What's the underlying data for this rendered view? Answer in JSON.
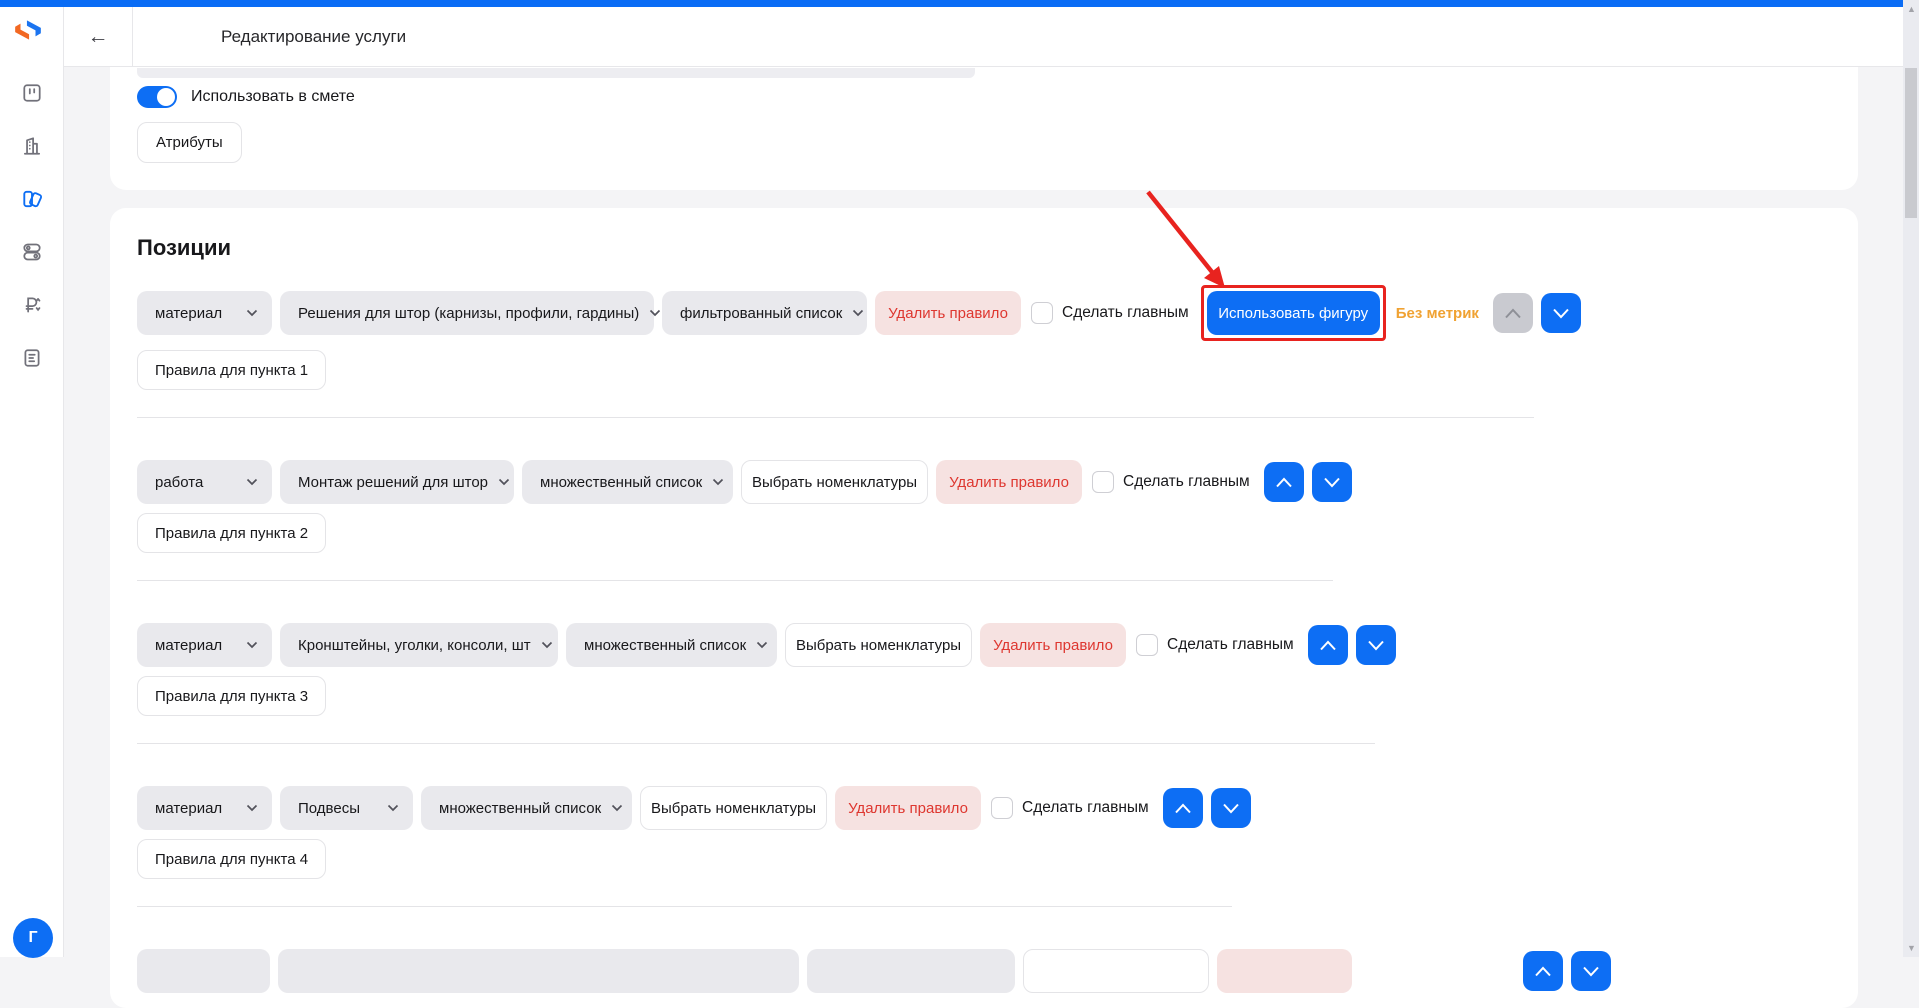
{
  "header": {
    "title": "Редактирование услуги",
    "back_icon": "arrow-left"
  },
  "sidebar": {
    "icons": [
      "kanban-board",
      "building",
      "swatches-active",
      "toggles",
      "ruble-sort",
      "document-list"
    ],
    "avatar_letter": "Г"
  },
  "scrollbar": {
    "up_glyph": "▲",
    "down_glyph": "▼"
  },
  "settings_card": {
    "toggle_label": "Использовать в смете",
    "toggle_on": true,
    "attributes_button": "Атрибуты"
  },
  "positions": {
    "title": "Позиции",
    "common": {
      "delete_label": "Удалить правило",
      "main_label": "Сделать главным",
      "select_label": "Выбрать номенклатуры"
    },
    "rows": [
      {
        "type": "материал",
        "category": "Решения для штор (карнизы, профили, гардины)",
        "list_type": "фильтрованный список",
        "figure_label": "Использовать фигуру",
        "metrics_label": "Без метрик",
        "rules_label": "Правила для пункта 1"
      },
      {
        "type": "работа",
        "category": "Монтаж решений для штор",
        "list_type": "множественный список",
        "rules_label": "Правила для пункта 2"
      },
      {
        "type": "материал",
        "category": "Кронштейны, уголки, консоли, шт",
        "list_type": "множественный список",
        "rules_label": "Правила для пункта 3"
      },
      {
        "type": "материал",
        "category": "Подвесы",
        "list_type": "множественный список",
        "rules_label": "Правила для пункта 4"
      }
    ]
  },
  "colors": {
    "accent_blue": "#0d6ef4",
    "top_strip_blue": "#0a6cf5",
    "danger_text": "#de3730",
    "danger_bg": "#f6e2e1",
    "warning_orange": "#f0a232",
    "annotation_red": "#e8231f",
    "page_bg": "#f4f4f6",
    "pill_bg": "#e9e9ed"
  }
}
